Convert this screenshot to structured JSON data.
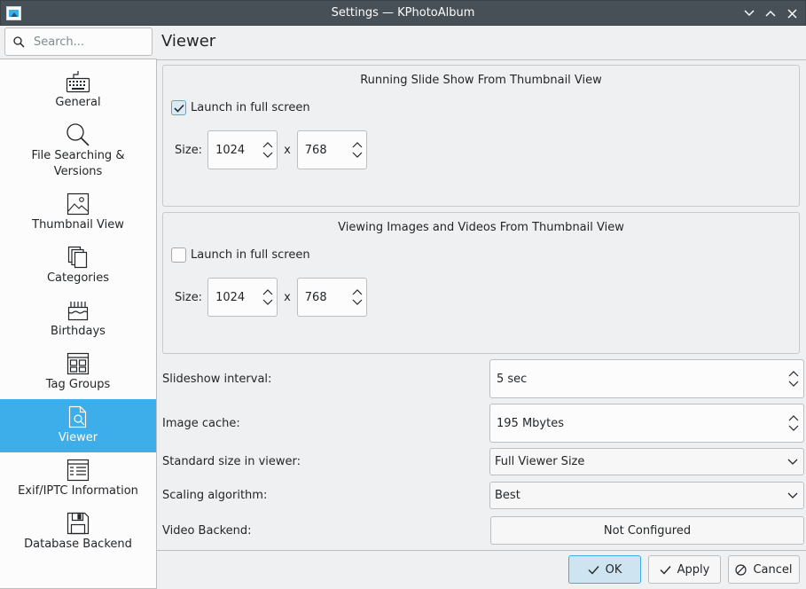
{
  "window": {
    "title": "Settings — KPhotoAlbum"
  },
  "search": {
    "placeholder": "Search..."
  },
  "sidebar": {
    "items": [
      {
        "label": "General",
        "icon": "keyboard-icon"
      },
      {
        "label": "File Searching &\nVersions",
        "icon": "magnifier-icon"
      },
      {
        "label": "Thumbnail View",
        "icon": "image-icon"
      },
      {
        "label": "Categories",
        "icon": "documents-icon"
      },
      {
        "label": "Birthdays",
        "icon": "cake-icon"
      },
      {
        "label": "Tag Groups",
        "icon": "grid-icon"
      },
      {
        "label": "Viewer",
        "icon": "document-search-icon",
        "selected": true
      },
      {
        "label": "Exif/IPTC Information",
        "icon": "table-icon"
      },
      {
        "label": "Database Backend",
        "icon": "floppy-icon"
      }
    ],
    "selected_color": "#3daee9"
  },
  "page": {
    "title": "Viewer"
  },
  "slideshow_group": {
    "title": "Running Slide Show From Thumbnail View",
    "fullscreen_label": "Launch in full screen",
    "fullscreen_checked": true,
    "size_label": "Size:",
    "width": "1024",
    "x_label": "x",
    "height": "768"
  },
  "viewing_group": {
    "title": "Viewing Images and Videos From Thumbnail View",
    "fullscreen_label": "Launch in full screen",
    "fullscreen_checked": false,
    "size_label": "Size:",
    "width": "1024",
    "x_label": "x",
    "height": "768"
  },
  "form": {
    "slideshow_interval_label": "Slideshow interval:",
    "slideshow_interval_value": "5 sec",
    "image_cache_label": "Image cache:",
    "image_cache_value": "195 Mbytes",
    "standard_size_label": "Standard size in viewer:",
    "standard_size_value": "Full Viewer Size",
    "scaling_label": "Scaling algorithm:",
    "scaling_value": "Best",
    "video_backend_label": "Video Backend:",
    "video_backend_value": "Not Configured"
  },
  "buttons": {
    "ok": "OK",
    "apply": "Apply",
    "cancel": "Cancel"
  }
}
